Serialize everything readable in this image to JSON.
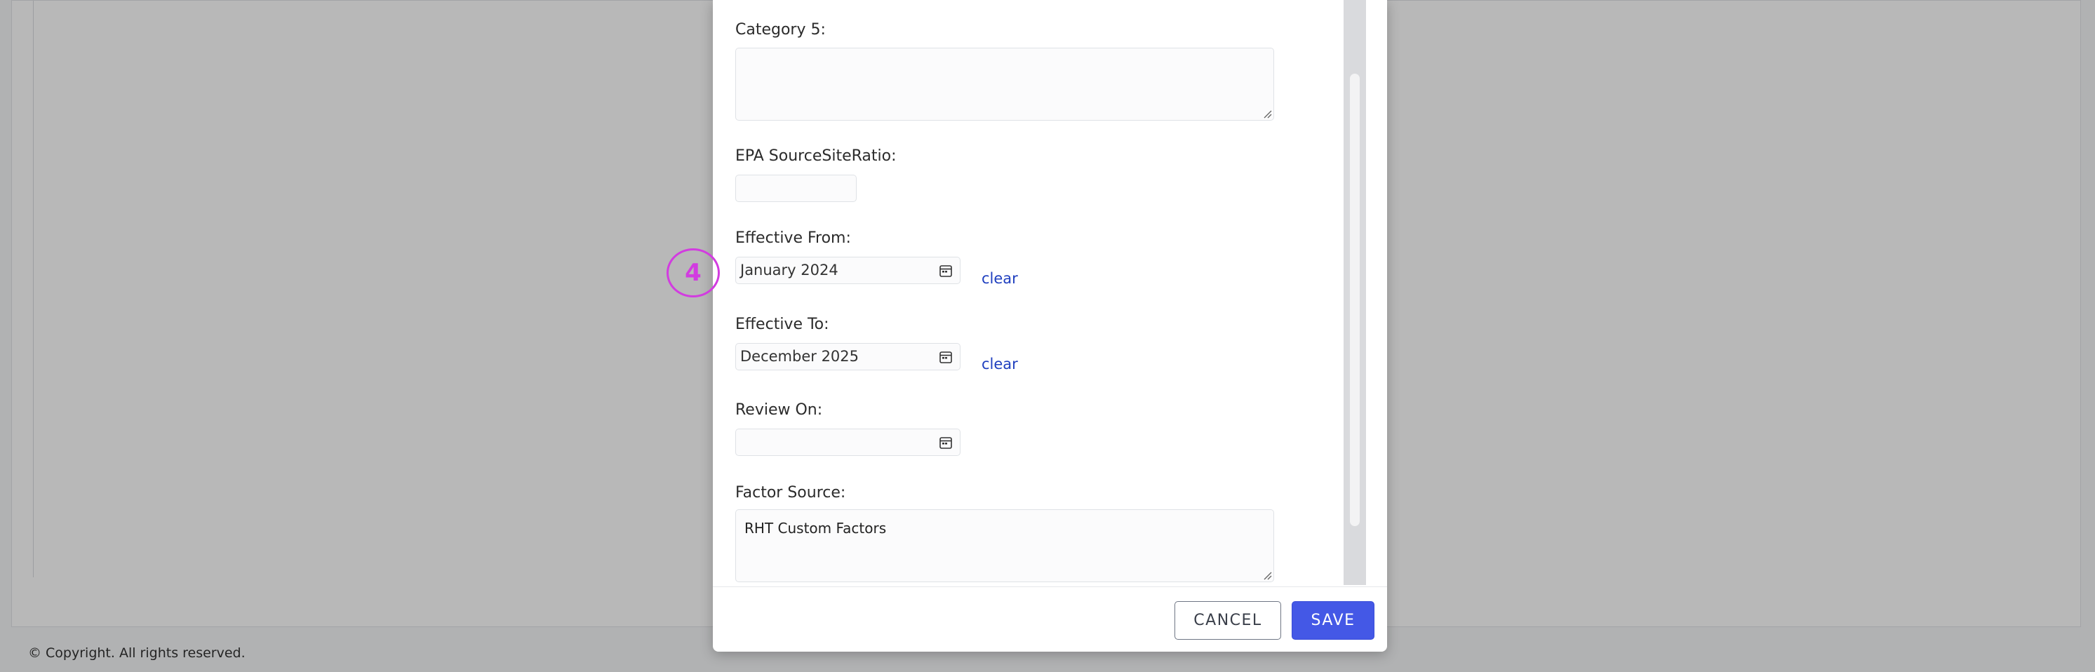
{
  "footer": {
    "copyright": "© Copyright. All rights reserved."
  },
  "modal": {
    "fields": {
      "category5": {
        "label": "Category 5:",
        "value": ""
      },
      "epa_ratio": {
        "label": "EPA SourceSiteRatio:",
        "value": ""
      },
      "effective_from": {
        "label": "Effective From:",
        "value": "January 2024",
        "clear": "clear"
      },
      "effective_to": {
        "label": "Effective To:",
        "value": "December 2025",
        "clear": "clear"
      },
      "review_on": {
        "label": "Review On:",
        "value": ""
      },
      "factor_source": {
        "label": "Factor Source:",
        "value": "RHT Custom Factors"
      }
    },
    "buttons": {
      "cancel": "CANCEL",
      "save": "SAVE"
    }
  },
  "annotation": {
    "marker_number": "4"
  },
  "colors": {
    "accent": "#4458e6",
    "link": "#1f3fbf",
    "marker": "#d23ce0"
  },
  "icons": {
    "date": "calendar-icon",
    "resize": "resize-grip-icon"
  }
}
